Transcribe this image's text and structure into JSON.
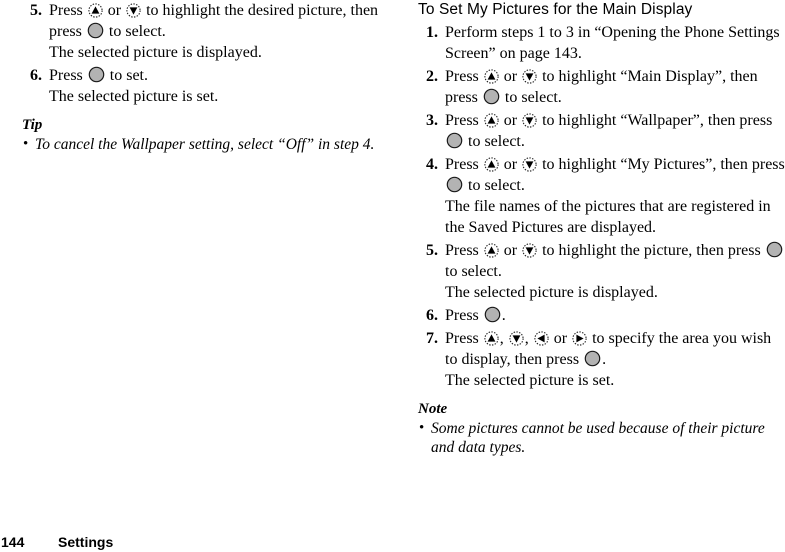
{
  "page": {
    "number": "144",
    "running_title": "Settings"
  },
  "icons": {
    "up": "dpad-up-icon",
    "down": "dpad-down-icon",
    "left": "dpad-left-icon",
    "right": "dpad-right-icon",
    "select": "center-select-key-icon",
    "colors": {
      "select_fill": "#b3b3b3",
      "select_stroke": "#1a1a1a",
      "arrow_fill": "#000000",
      "arrow_ring": "#1a1a1a"
    }
  },
  "left_column": {
    "steps": [
      {
        "number": "5.",
        "parts": [
          "Press ",
          "[up]",
          " or ",
          "[down]",
          " to highlight the desired picture, then press ",
          "[select]",
          " to select."
        ],
        "text_a": "Press ",
        "text_b": " or ",
        "text_c": " to highlight the desired picture, then press ",
        "text_d": " to select.",
        "result": "The selected picture is displayed."
      },
      {
        "number": "6.",
        "text_a": "Press ",
        "text_d": " to set.",
        "result": "The selected picture is set."
      }
    ],
    "tip": {
      "heading": "Tip",
      "bullet_marker": "•",
      "items": [
        "To cancel the Wallpaper setting, select “Off” in step 4."
      ]
    }
  },
  "right_column": {
    "heading": "To Set My Pictures for the Main Display",
    "steps": [
      {
        "number": "1.",
        "text": "Perform steps 1 to 3 in “Opening the Phone Settings Screen” on page 143."
      },
      {
        "number": "2.",
        "text_a": "Press ",
        "text_b": " or ",
        "text_c": " to highlight “Main Display”, then press ",
        "text_d": " to select."
      },
      {
        "number": "3.",
        "text_a": "Press ",
        "text_b": " or ",
        "text_c": " to highlight “Wallpaper”, then press ",
        "text_d": " to select."
      },
      {
        "number": "4.",
        "text_a": "Press ",
        "text_b": " or ",
        "text_c": " to highlight “My Pictures”, then press ",
        "text_d": " to select.",
        "result": "The file names of the pictures that are registered in the Saved Pictures are displayed."
      },
      {
        "number": "5.",
        "text_a": "Press ",
        "text_b": " or ",
        "text_c": " to highlight the picture, then press ",
        "text_d": " to select.",
        "result": "The selected picture is displayed."
      },
      {
        "number": "6.",
        "text_a": "Press ",
        "text_d": "."
      },
      {
        "number": "7.",
        "text_a": "Press ",
        "text_b": ", ",
        "text_b2": ", ",
        "text_c": " or ",
        "text_c2": " to specify the area you wish to display, then press ",
        "text_d": ".",
        "result": "The selected picture is set."
      }
    ],
    "note": {
      "heading": "Note",
      "bullet_marker": "•",
      "items": [
        "Some pictures cannot be used because of their picture and data types."
      ]
    }
  }
}
